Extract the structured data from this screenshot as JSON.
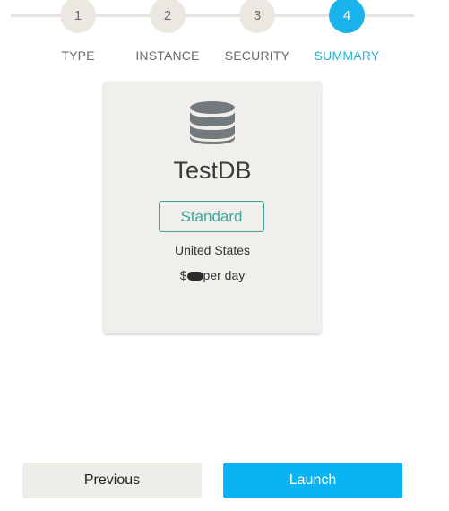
{
  "stepper": {
    "steps": [
      {
        "number": "1",
        "label": "TYPE"
      },
      {
        "number": "2",
        "label": "INSTANCE"
      },
      {
        "number": "3",
        "label": "SECURITY"
      },
      {
        "number": "4",
        "label": "SUMMARY"
      }
    ],
    "active_step": 4
  },
  "summary_card": {
    "icon": "database-icon",
    "name": "TestDB",
    "tier": "Standard",
    "region": "United States",
    "price_prefix": "$",
    "price_suffix": "per day"
  },
  "actions": {
    "previous_label": "Previous",
    "launch_label": "Launch"
  },
  "colors": {
    "accent": "#0ab3f2",
    "active_step_text": "#29b1cf",
    "badge": "#3aa79c",
    "inactive_step": "#ebe8e1",
    "card_bg": "#f1efeb"
  }
}
